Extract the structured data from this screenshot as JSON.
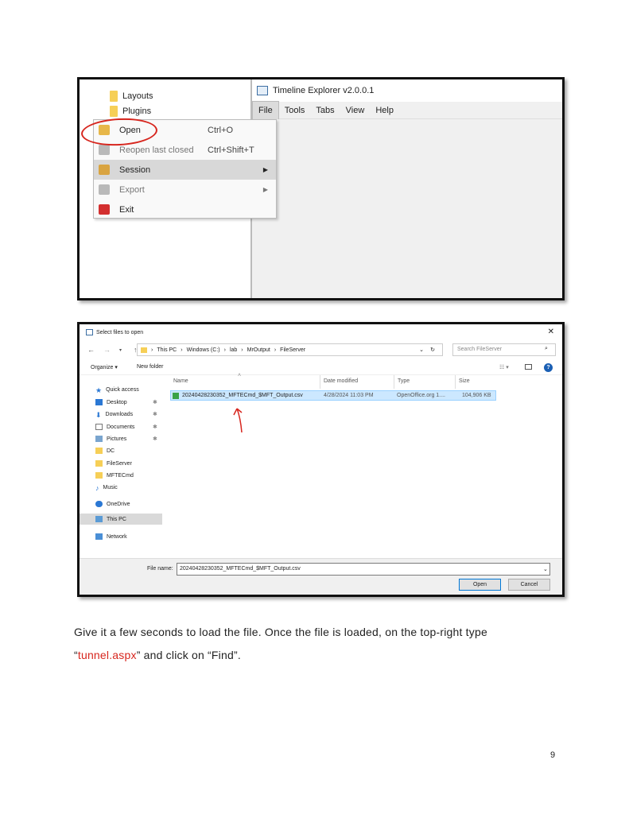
{
  "screenshot1": {
    "tree_items": [
      "Layouts",
      "Plugins"
    ],
    "app_title": "Timeline Explorer v2.0.0.1",
    "menu": [
      "File",
      "Tools",
      "Tabs",
      "View",
      "Help"
    ],
    "file_menu": [
      {
        "label": "Open",
        "shortcut": "Ctrl+O"
      },
      {
        "label": "Reopen last closed",
        "shortcut": "Ctrl+Shift+T"
      },
      {
        "label": "Session",
        "shortcut": ""
      },
      {
        "label": "Export",
        "shortcut": ""
      },
      {
        "label": "Exit",
        "shortcut": ""
      }
    ]
  },
  "screenshot2": {
    "title": "Select files to open",
    "close": "✕",
    "path": [
      "This PC",
      "Windows (C:)",
      "lab",
      "MrOutput",
      "FileServer"
    ],
    "search_placeholder": "Search FileServer",
    "organize": "Organize ▾",
    "new_folder": "New folder",
    "nav": {
      "quick_access": "Quick access",
      "desktop": "Desktop",
      "downloads": "Downloads",
      "documents": "Documents",
      "pictures": "Pictures",
      "dc": "DC",
      "fileserver": "FileServer",
      "mftecmd": "MFTECmd",
      "music": "Music",
      "onedrive": "OneDrive",
      "thispc": "This PC",
      "network": "Network"
    },
    "columns": {
      "name": "Name",
      "date": "Date modified",
      "type": "Type",
      "size": "Size"
    },
    "file": {
      "name": "20240428230352_MFTECmd_$MFT_Output.csv",
      "date": "4/28/2024 11:03 PM",
      "type": "OpenOffice.org 1....",
      "size": "104,906 KB"
    },
    "file_name_label": "File name:",
    "file_name_value": "20240428230352_MFTECmd_$MFT_Output.csv",
    "open_button": "Open",
    "cancel_button": "Cancel"
  },
  "caption": {
    "part1": "Give it a few seconds to load the file. Once the file is loaded, on the top-right type",
    "quote_open": "“",
    "red": "tunnel.aspx",
    "part2": "” and click on “Find”."
  },
  "page_number": "9",
  "colors": {
    "annotation_red": "#d7261e",
    "selection_blue": "#cce8ff"
  }
}
